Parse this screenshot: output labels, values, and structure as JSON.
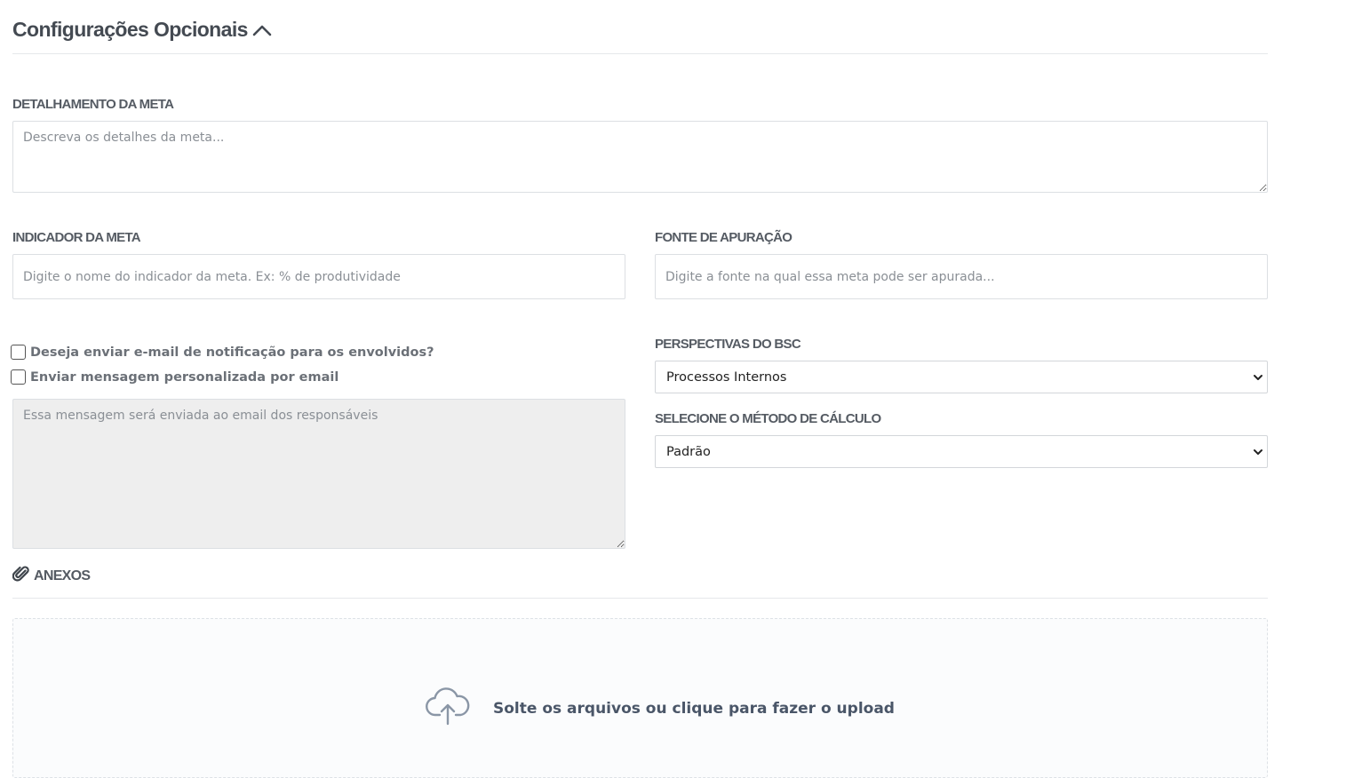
{
  "section": {
    "title": "Configurações Opcionais"
  },
  "detalhamento": {
    "label": "DETALHAMENTO DA META",
    "placeholder": "Descreva os detalhes da meta..."
  },
  "indicador": {
    "label": "INDICADOR DA META",
    "placeholder": "Digite o nome do indicador da meta. Ex: % de produtividade"
  },
  "fonte": {
    "label": "FONTE DE APURAÇÃO",
    "placeholder": "Digite a fonte na qual essa meta pode ser apurada..."
  },
  "notificacao": {
    "email_checkbox_label": "Deseja enviar e-mail de notificação para os envolvidos?",
    "custom_message_checkbox_label": "Enviar mensagem personalizada por email",
    "message_placeholder": "Essa mensagem será enviada ao email dos responsáveis"
  },
  "perspectivas": {
    "label": "PERSPECTIVAS DO BSC",
    "selected": "Processos Internos"
  },
  "metodo": {
    "label": "SELECIONE O MÉTODO DE CÁLCULO",
    "selected": "Padrão"
  },
  "anexos": {
    "label": "ANEXOS",
    "icon": "paperclip-icon",
    "dropzone_text": "Solte os arquivos ou clique para fazer o upload",
    "dropzone_icon": "cloud-upload-icon"
  },
  "colors": {
    "title": "#444a52",
    "label": "#555b63",
    "border": "#dcdfe3",
    "disabled_bg": "#eeeeee",
    "dropzone_text": "#4a5668"
  }
}
